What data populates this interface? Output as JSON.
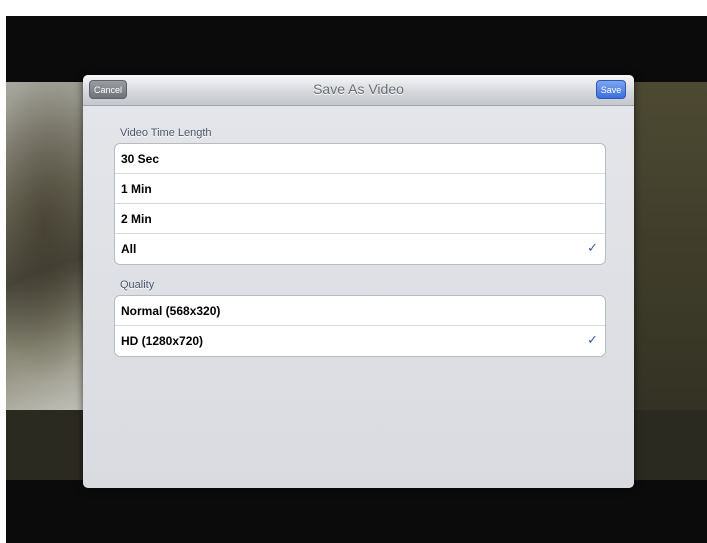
{
  "dialog": {
    "title": "Save As Video",
    "cancel_label": "Cancel",
    "save_label": "Save"
  },
  "video_length": {
    "header": "Video Time Length",
    "options": [
      {
        "label": "30 Sec",
        "selected": false
      },
      {
        "label": "1 Min",
        "selected": false
      },
      {
        "label": "2 Min",
        "selected": false
      },
      {
        "label": "All",
        "selected": true
      }
    ]
  },
  "quality": {
    "header": "Quality",
    "options": [
      {
        "label": "Normal (568x320)",
        "selected": false
      },
      {
        "label": "HD (1280x720)",
        "selected": true
      }
    ]
  },
  "icons": {
    "checkmark": "checkmark-icon"
  },
  "colors": {
    "save_button": "#3a6fe0",
    "checkmark": "#3b5a9a"
  }
}
